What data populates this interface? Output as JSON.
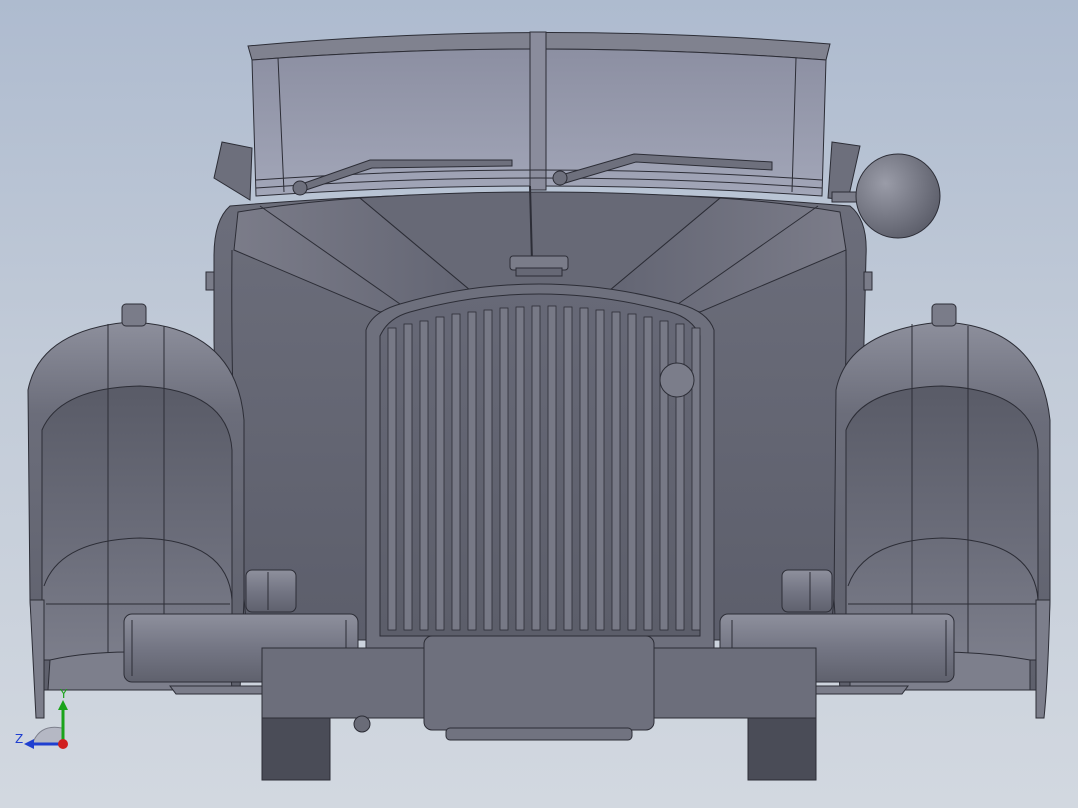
{
  "viewport": {
    "background_top": "#aebbcf",
    "background_bottom": "#d2d8e0",
    "model_color": "#70717e",
    "model_edge_color": "#2c2d36"
  },
  "model": {
    "parts": [
      "windshield-frame",
      "windshield-glass",
      "wiper-left",
      "wiper-right",
      "side-mirror-left",
      "side-mirror-right",
      "hood",
      "radiator-cap",
      "radiator-grille",
      "fender-left",
      "fender-right",
      "bumper-bar-left",
      "bumper-bar-right",
      "front-bumper",
      "license-plate",
      "wheel-left",
      "wheel-right"
    ]
  },
  "triad": {
    "y_label": "Y",
    "z_label": "Z",
    "y_color": "#1aa31a",
    "z_color": "#1f3fd0",
    "x_color": "#d01f1f"
  }
}
